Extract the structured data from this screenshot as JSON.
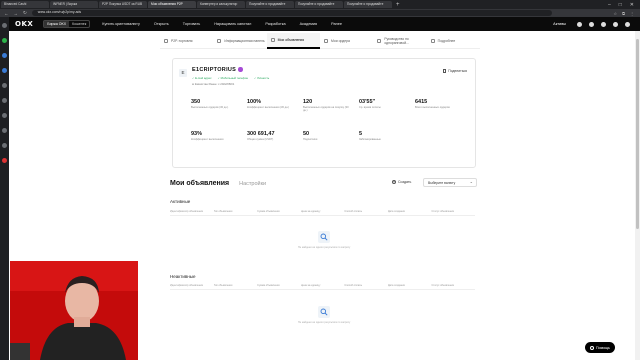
{
  "browser": {
    "tabs": [
      {
        "label": "Binanced Cashi"
      },
      {
        "label": "INFNER | Биржа"
      },
      {
        "label": "P2P Покупка USDT за RUB"
      },
      {
        "label": "Мои объявления P2P"
      },
      {
        "label": "Конвертер и калькулятор"
      },
      {
        "label": "Покупайте и продавайте"
      },
      {
        "label": "Покупайте и продавайте"
      },
      {
        "label": "Покупайте и продавайте"
      }
    ],
    "url": "www.okx.com/ru/p2p/my-ads"
  },
  "header": {
    "logo": "OKX",
    "mode": [
      "Биржа OKX",
      "Кошелек"
    ],
    "nav": [
      "Купить криптовалюту",
      "Открыть",
      "Торговать",
      "Наращивать капитал",
      "Разработка",
      "Академия",
      "Ранее"
    ],
    "assets": "Активы"
  },
  "subtabs": [
    {
      "label": "P2P-торговля",
      "icon": "exchange-icon"
    },
    {
      "label": "Информационная панель",
      "icon": "dashboard-icon"
    },
    {
      "label": "Мои объявления",
      "icon": "ads-icon"
    },
    {
      "label": "Мои ордера",
      "icon": "orders-icon"
    },
    {
      "label": "Руководство по одноранговой...",
      "icon": "guide-icon"
    },
    {
      "label": "Подробнее",
      "icon": "more-icon"
    }
  ],
  "profile": {
    "avatar_letter": "E",
    "username": "E1CRIPTORIUS",
    "badges": [
      "✓ E-mail адрес",
      "✓ Мобильный телефон",
      "✓ Личность"
    ],
    "meta": "м Казахстан    Ранее: с 2022/08/01",
    "share": "Поделиться",
    "stats": [
      {
        "value": "350",
        "label": "Выполненных ордеров (30 дн.)"
      },
      {
        "value": "100%",
        "label": "Коэффициент выполнения (30 дн.)"
      },
      {
        "value": "120",
        "label": "Выполненных ордеров на покупку (30 дн.)"
      },
      {
        "value": "03'55\"",
        "label": "Ср. время оплаты"
      },
      {
        "value": "6415",
        "label": "Всего выполненных ордеров"
      },
      {
        "value": "93%",
        "label": "Коэффициент выполнения"
      },
      {
        "value": "300 691,47",
        "label": "Общая сумма (USDT)"
      },
      {
        "value": "50",
        "label": "Подписчики"
      },
      {
        "value": "5",
        "label": "Заблокированные"
      }
    ]
  },
  "ads": {
    "title": "Мои объявления",
    "settings": "Настройки",
    "create": "Создать",
    "select_placeholder": "Выберите валюту",
    "active_title": "Активные",
    "inactive_title": "Неактивные",
    "columns": [
      "Идентификатор объявления",
      "Тип объявления",
      "Сумма объявления",
      "Цена за единицу",
      "Способ оплаты",
      "Дата создания",
      "Статус объявления"
    ],
    "empty_text": "Не найдено ни одного результата по запросу"
  },
  "help": {
    "label": "Помощь"
  }
}
